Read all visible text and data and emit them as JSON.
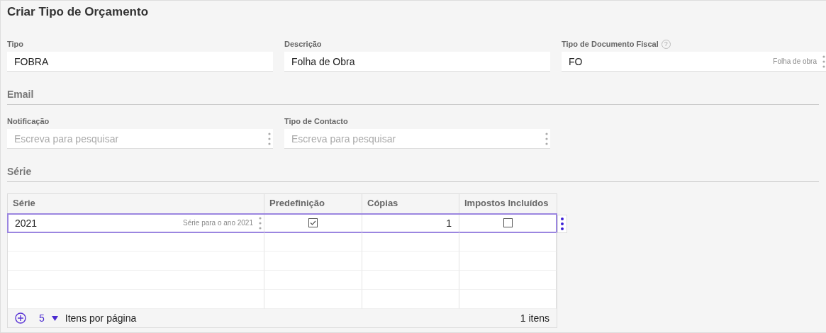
{
  "title": "Criar Tipo de Orçamento",
  "fields": [
    {
      "label": "Tipo",
      "value": "FOBRA"
    },
    {
      "label": "Descrição",
      "value": "Folha de Obra"
    },
    {
      "label": "Tipo de Documento Fiscal",
      "value": "FO",
      "hint": "Folha de obra",
      "help": "?",
      "menu": true
    }
  ],
  "email": {
    "heading": "Email",
    "fields": [
      {
        "label": "Notificação",
        "placeholder": "Escreva para pesquisar"
      },
      {
        "label": "Tipo de Contacto",
        "placeholder": "Escreva para pesquisar"
      }
    ]
  },
  "series": {
    "heading": "Série",
    "table": {
      "columns": [
        "Série",
        "Predefinição",
        "Cópias",
        "Impostos Incluídos"
      ],
      "rows": [
        {
          "serie": "2021",
          "description": "Série para o ano 2021",
          "default": true,
          "copies": "1",
          "taxes_included": false,
          "selected": true
        }
      ],
      "page_size": "5",
      "page_size_label": "Itens por página",
      "count": "1 itens"
    }
  }
}
